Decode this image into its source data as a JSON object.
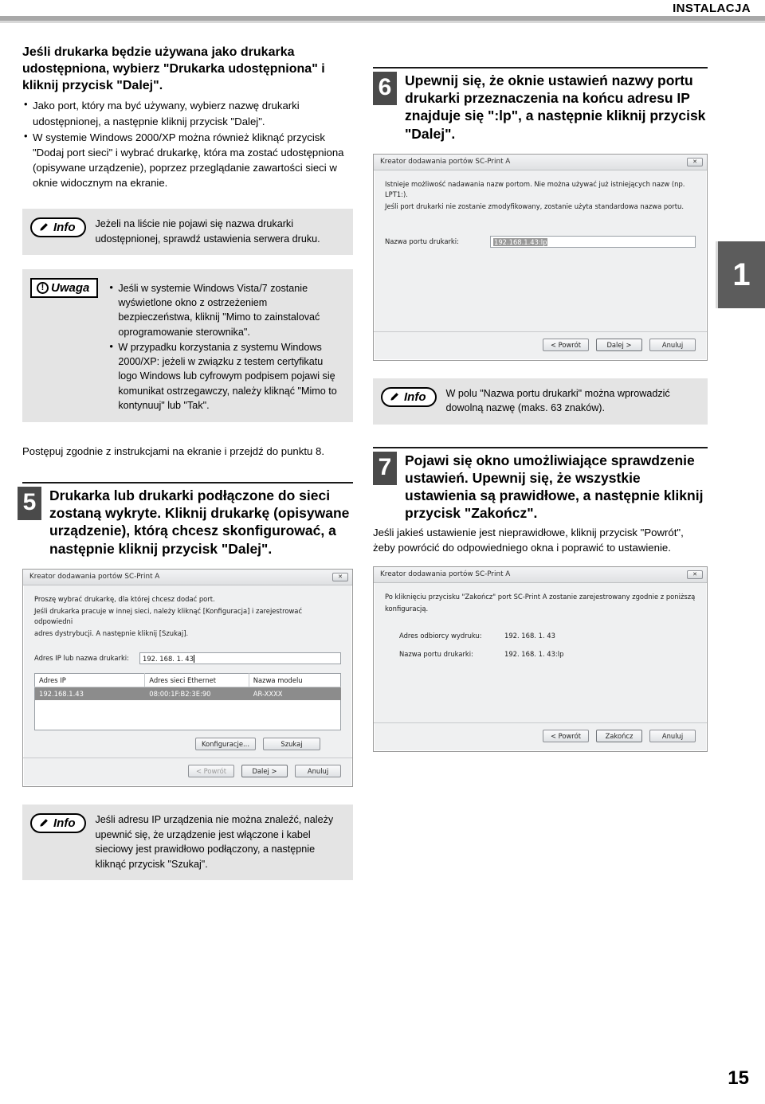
{
  "header": {
    "title": "INSTALACJA"
  },
  "chapter_tab": "1",
  "page_number": "15",
  "left_column": {
    "intro": {
      "bold_lead": "Jeśli drukarka będzie używana jako drukarka udostępniona, wybierz \"Drukarka udostępniona\" i kliknij przycisk \"Dalej\".",
      "bullets": [
        "Jako port, który ma być używany, wybierz nazwę drukarki udostępnionej, a następnie kliknij przycisk \"Dalej\".",
        "W systemie Windows 2000/XP można również kliknąć przycisk \"Dodaj port sieci\" i wybrać drukarkę, która ma zostać udostępniona (opisywane urządzenie), poprzez przeglądanie zawartości sieci w oknie widocznym na ekranie."
      ]
    },
    "info_1": {
      "badge_label": "Info",
      "text": "Jeżeli na liście nie pojawi się nazwa drukarki udostępnionej, sprawdź ustawienia serwera druku."
    },
    "uwaga": {
      "badge_label": "Uwaga",
      "bullets": [
        "Jeśli w systemie Windows Vista/7 zostanie wyświetlone okno z ostrzeżeniem bezpieczeństwa, kliknij \"Mimo to zainstalovać oprogramowanie sterownika\".",
        "W przypadku korzystania z systemu Windows 2000/XP: jeżeli w związku z testem certyfikatu logo Windows lub cyfrowym podpisem pojawi się komunikat ostrzegawczy, należy kliknąć \"Mimo to kontynuuj\" lub \"Tak\"."
      ]
    },
    "follow_note": "Postępuj zgodnie z instrukcjami na ekranie i przejdź do punktu 8.",
    "step5": {
      "number": "5",
      "title": "Drukarka lub drukarki podłączone do sieci zostaną wykryte. Kliknij drukarkę (opisywane urządzenie), którą chcesz skonfigurować, a następnie kliknij przycisk \"Dalej\"."
    },
    "dialog_select_printer": {
      "titlebar": "Kreator dodawania portów SC-Print A",
      "close_glyph": "✕",
      "paragraphs": [
        "Proszę wybrać drukarkę, dla której chcesz dodać port.",
        "Jeśli drukarka pracuje w innej sieci, należy kliknąć [Konfiguracja] i zarejestrować odpowiedni",
        "adres dystrybucji. A następnie kliknij [Szukaj]."
      ],
      "field_label": "Adres IP lub nazwa drukarki:",
      "field_value": "192. 168. 1. 43",
      "table": {
        "headers": [
          "Adres IP",
          "Adres sieci Ethernet",
          "Nazwa modelu"
        ],
        "rows": [
          [
            "192.168.1.43",
            "08:00:1F:B2:3E:90",
            "AR-XXXX"
          ]
        ]
      },
      "mid_buttons": [
        "Konfiguracje...",
        "Szukaj"
      ],
      "footer_buttons": [
        "< Powrót",
        "Dalej >",
        "Anuluj"
      ]
    },
    "info_2": {
      "badge_label": "Info",
      "text": "Jeśli adresu IP urządzenia nie można znaleźć, należy upewnić się, że urządzenie jest włączone i kabel sieciowy jest prawidłowo podłączony, a następnie kliknąć przycisk \"Szukaj\"."
    }
  },
  "right_column": {
    "step6": {
      "number": "6",
      "title": "Upewnij się, że oknie ustawień nazwy portu drukarki przeznaczenia na końcu adresu IP znajduje się \":lp\", a następnie kliknij przycisk \"Dalej\"."
    },
    "dialog_port_name": {
      "titlebar": "Kreator dodawania portów SC-Print A",
      "close_glyph": "✕",
      "paragraphs": [
        "Istnieje możliwość nadawania nazw portom. Nie można używać już istniejących nazw (np. LPT1:).",
        "Jeśli port drukarki nie zostanie zmodyfikowany, zostanie użyta standardowa nazwa portu."
      ],
      "field_label": "Nazwa portu drukarki:",
      "field_value": "192.168.1.43:lp",
      "footer_buttons": [
        "< Powrót",
        "Dalej >",
        "Anuluj"
      ]
    },
    "info_3": {
      "badge_label": "Info",
      "text": "W polu \"Nazwa portu drukarki\" można wprowadzić dowolną nazwę (maks. 63 znaków)."
    },
    "step7": {
      "number": "7",
      "title": "Pojawi się okno umożliwiające sprawdzenie ustawień. Upewnij się, że wszystkie ustawienia są prawidłowe, a następnie kliknij przycisk \"Zakończ\".",
      "subnote": "Jeśli jakieś ustawienie jest nieprawidłowe, kliknij przycisk \"Powrót\", żeby powrócić do odpowiedniego okna i poprawić to ustawienie."
    },
    "dialog_confirm": {
      "titlebar": "Kreator dodawania portów SC-Print A",
      "close_glyph": "✕",
      "paragraphs": [
        "Po kliknięciu przycisku \"Zakończ\" port SC-Print A zostanie zarejestrowany zgodnie z poniższą",
        "konfiguracją."
      ],
      "rows": [
        {
          "key": "Adres odbiorcy wydruku:",
          "value": "192. 168. 1. 43"
        },
        {
          "key": "Nazwa portu drukarki:",
          "value": "192. 168. 1. 43:lp"
        }
      ],
      "footer_buttons": [
        "< Powrót",
        "Zakończ",
        "Anuluj"
      ]
    }
  }
}
